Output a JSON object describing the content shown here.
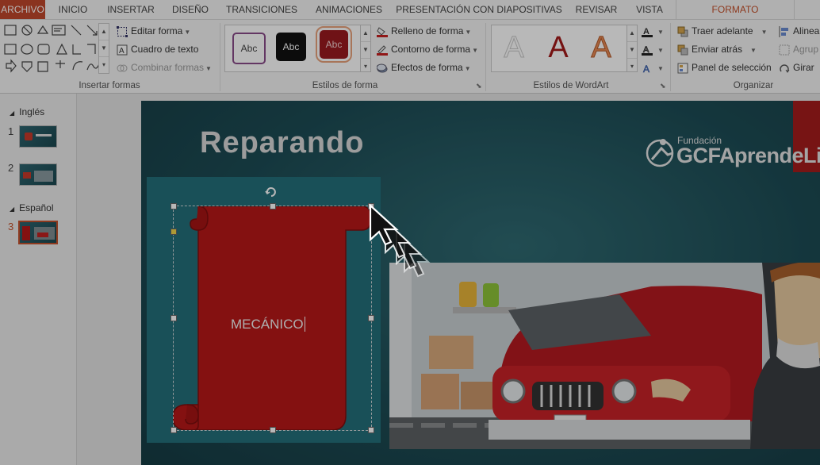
{
  "tabs": [
    "ARCHIVO",
    "INICIO",
    "INSERTAR",
    "DISEÑO",
    "TRANSICIONES",
    "ANIMACIONES",
    "PRESENTACIÓN CON DIAPOSITIVAS",
    "REVISAR",
    "VISTA",
    "FORMATO"
  ],
  "ribbon": {
    "insert_shapes": {
      "label": "Insertar formas",
      "edit_shape": "Editar forma",
      "text_box": "Cuadro de texto",
      "merge_shapes": "Combinar formas"
    },
    "shape_styles": {
      "label": "Estilos de forma",
      "thumb_text": "Abc",
      "fill": "Relleno de forma",
      "outline": "Contorno de forma",
      "effects": "Efectos de forma"
    },
    "wordart": {
      "label": "Estilos de WordArt",
      "glyph": "A"
    },
    "arrange": {
      "label": "Organizar",
      "bring_forward": "Traer adelante",
      "send_backward": "Enviar atrás",
      "selection_pane": "Panel de selección",
      "align": "Alinea",
      "group": "Agrup",
      "rotate": "Girar"
    }
  },
  "pane": {
    "sections": [
      {
        "name": "Inglés",
        "slides": [
          "1",
          "2"
        ]
      },
      {
        "name": "Español",
        "slides": [
          "3"
        ]
      }
    ]
  },
  "slide": {
    "title": "Reparando",
    "logo_small": "Fundación",
    "logo_big": "GCFAprendeLib",
    "shape_text": "MECÁNICO"
  },
  "colors": {
    "accent": "#c5512c",
    "scroll_red": "#b81818",
    "slide_bg": "#1d4c55"
  }
}
